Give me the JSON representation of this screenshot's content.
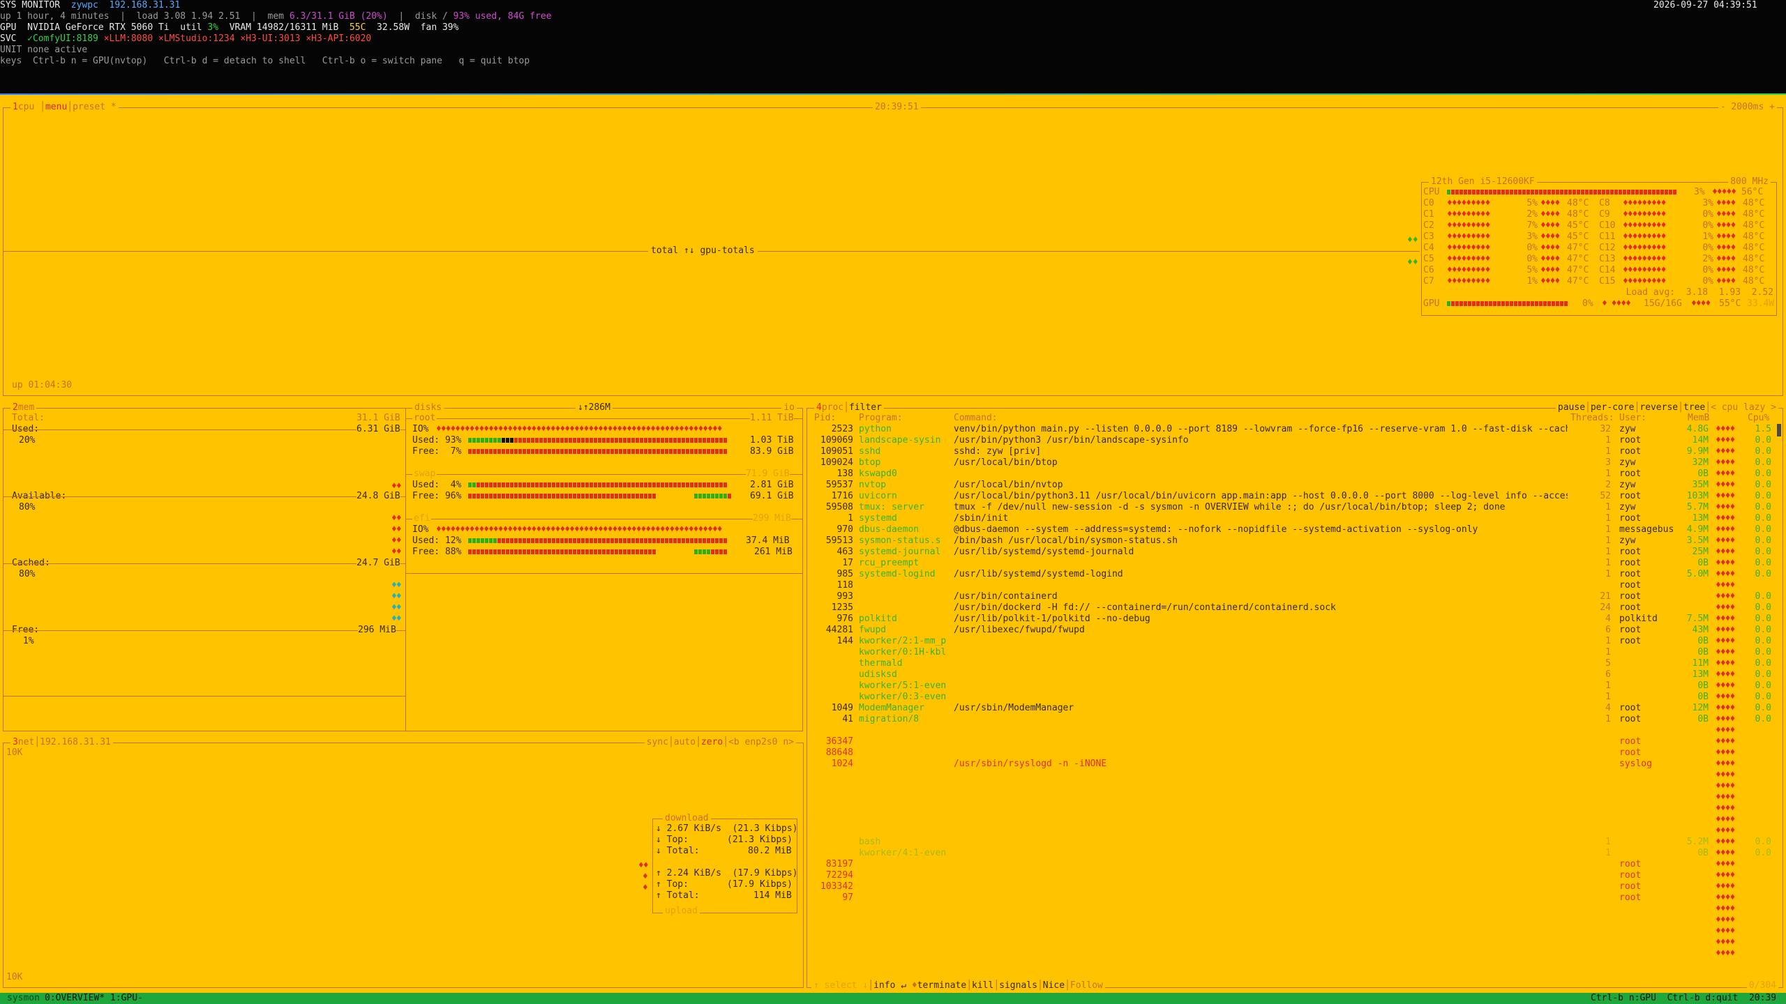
{
  "header": {
    "title": "SYS MONITOR",
    "host": "zywpc",
    "ip": "192.168.31.31",
    "datetime": "2026-09-27 04:39:51",
    "uptime_line": "up 1 hour, 4 minutes  |  load 3.08 1.94 2.51  |  mem ",
    "mem_value": "6.3/31.1 GiB (20%)",
    "disk_label": "  |  disk / ",
    "disk_value": "93% used, 84G free",
    "gpu_label": "GPU  NVIDIA GeForce RTX 5060 Ti  util ",
    "gpu_util": "3%",
    "gpu_vram": "  VRAM 14982/16311 MiB  ",
    "gpu_temp": "55C",
    "gpu_power": "  32.58W  fan 39%",
    "svc_label": "SVC  ",
    "svc_comfy": "✓ComfyUI:8189 ",
    "svc_llm": "×LLM:8080 ",
    "svc_lmstudio": "×LMStudio:1234 ",
    "svc_h3ui": "×H3-UI:3013 ",
    "svc_h3api": "×H3-API:6020",
    "unit_line": "UNIT none active",
    "keys_line": "keys  Ctrl-b n = GPU(nvtop)   Ctrl-b d = detach to shell   Ctrl-b o = switch pane   q = quit btop"
  },
  "cpu_panel": {
    "title_num": "1",
    "title": "cpu",
    "menu": "menu",
    "preset": "preset *",
    "clock": "20:39:51",
    "interval": "- 2000ms +",
    "graph_label": "total ↑↓ gpu-totals",
    "uptime": "up 01:04:30",
    "cpu_model": "12th Gen i5-12600KF",
    "cpu_freq": "800 MHz",
    "cpu_total_label": "CPU",
    "cpu_total_pct": "3%",
    "cpu_total_temp": "56°C",
    "cores_left": [
      {
        "name": "C0",
        "pct": "5%",
        "temp": "48°C"
      },
      {
        "name": "C1",
        "pct": "2%",
        "temp": "48°C"
      },
      {
        "name": "C2",
        "pct": "7%",
        "temp": "45°C"
      },
      {
        "name": "C3",
        "pct": "3%",
        "temp": "45°C"
      },
      {
        "name": "C4",
        "pct": "0%",
        "temp": "47°C"
      },
      {
        "name": "C5",
        "pct": "0%",
        "temp": "47°C"
      },
      {
        "name": "C6",
        "pct": "5%",
        "temp": "47°C"
      },
      {
        "name": "C7",
        "pct": "1%",
        "temp": "47°C"
      }
    ],
    "cores_right": [
      {
        "name": "C8",
        "pct": "3%",
        "temp": "48°C"
      },
      {
        "name": "C9",
        "pct": "0%",
        "temp": "48°C"
      },
      {
        "name": "C10",
        "pct": "0%",
        "temp": "48°C"
      },
      {
        "name": "C11",
        "pct": "1%",
        "temp": "48°C"
      },
      {
        "name": "C12",
        "pct": "0%",
        "temp": "48°C"
      },
      {
        "name": "C13",
        "pct": "2%",
        "temp": "48°C"
      },
      {
        "name": "C14",
        "pct": "0%",
        "temp": "48°C"
      },
      {
        "name": "C15",
        "pct": "0%",
        "temp": "48°C"
      }
    ],
    "load_avg": "Load avg:  3.18  1.93  2.52",
    "gpu_label": "GPU",
    "gpu_pct": "0%",
    "gpu_mem": "15G/16G",
    "gpu_temp": "55°C",
    "gpu_power": "33.4W"
  },
  "mem_panel": {
    "title_num": "2",
    "title": "mem",
    "total_label": "Total:",
    "total_value": "31.1 GiB",
    "used_label": "Used:",
    "used_value": "6.31 GiB",
    "used_pct": "20%",
    "avail_label": "Available:",
    "avail_value": "24.8 GiB",
    "avail_pct": "80%",
    "cached_label": "Cached:",
    "cached_value": "24.7 GiB",
    "cached_pct": "80%",
    "free_label": "Free:",
    "free_value": "296 MiB",
    "free_pct": "1%"
  },
  "disks_panel": {
    "title": "disks",
    "io_label": "io",
    "io_value": "↓↑286M",
    "root": {
      "name": "root",
      "size": "1.11 TiB",
      "io": "IO%",
      "used_label": "Used:",
      "used_pct": "93%",
      "used_val": "1.03 TiB",
      "free_label": "Free:",
      "free_pct": "7%",
      "free_val": "83.9 GiB"
    },
    "swap": {
      "name": "swap",
      "size": "71.9 GiB",
      "used_label": "Used:",
      "used_pct": "4%",
      "used_val": "2.81 GiB",
      "free_label": "Free:",
      "free_pct": "96%",
      "free_val": "69.1 GiB"
    },
    "efi": {
      "name": "efi",
      "size": "299 MiB",
      "io": "IO%",
      "used_label": "Used:",
      "used_pct": "12%",
      "used_val": "37.4 MiB",
      "free_label": "Free:",
      "free_pct": "88%",
      "free_val": "261 MiB"
    }
  },
  "net_panel": {
    "title_num": "3",
    "title": "net",
    "ip": "192.168.31.31",
    "sync": "sync",
    "auto": "auto",
    "zero": "zero",
    "b": "<b",
    "iface": "enp2s0",
    "n": "n>",
    "scale_top": "10K",
    "scale_bottom": "10K",
    "download_title": "download",
    "dl_rate": "2.67 KiB/s  (21.3 Kibps)",
    "dl_top_label": "Top:",
    "dl_top": "(21.3 Kibps)",
    "dl_total_label": "Total:",
    "dl_total": "80.2 MiB",
    "ul_rate": "2.24 KiB/s  (17.9 Kibps)",
    "ul_top_label": "Top:",
    "ul_top": "(17.9 Kibps)",
    "ul_total_label": "Total:",
    "ul_total": "114 MiB",
    "upload_title": "upload"
  },
  "proc_panel": {
    "title_num": "4",
    "title": "proc",
    "filter": "filter",
    "pause": "pause",
    "per_core": "per-core",
    "reverse": "reverse",
    "tree": "tree",
    "sort": "< cpu lazy >",
    "headers": {
      "pid": "Pid:",
      "program": "Program:",
      "command": "Command:",
      "threads": "Threads:",
      "user": "User:",
      "mem": "MemB",
      "cpu": "Cpu%"
    },
    "rows": [
      {
        "pid": "2523",
        "prog": "python",
        "cmd": "venv/bin/python main.py --listen 0.0.0.0 --port 8189 --lowvram --force-fp16 --reserve-vram 1.0 --fast-disk --cach",
        "thr": "32",
        "user": "zyw",
        "mem": "4.8G",
        "cpu": "1.5"
      },
      {
        "pid": "109069",
        "prog": "landscape-sysin",
        "cmd": "/usr/bin/python3 /usr/bin/landscape-sysinfo",
        "thr": "1",
        "user": "root",
        "mem": "14M",
        "cpu": "0.0"
      },
      {
        "pid": "109051",
        "prog": "sshd",
        "cmd": "sshd: zyw [priv]",
        "thr": "1",
        "user": "root",
        "mem": "9.9M",
        "cpu": "0.0"
      },
      {
        "pid": "109024",
        "prog": "btop",
        "cmd": "/usr/local/bin/btop",
        "thr": "3",
        "user": "zyw",
        "mem": "32M",
        "cpu": "0.0"
      },
      {
        "pid": "138",
        "prog": "kswapd0",
        "cmd": "",
        "thr": "1",
        "user": "root",
        "mem": "0B",
        "cpu": "0.0"
      },
      {
        "pid": "59537",
        "prog": "nvtop",
        "cmd": "/usr/local/bin/nvtop",
        "thr": "2",
        "user": "zyw",
        "mem": "35M",
        "cpu": "0.0"
      },
      {
        "pid": "1716",
        "prog": "uvicorn",
        "cmd": "/usr/local/bin/python3.11 /usr/local/bin/uvicorn app.main:app --host 0.0.0.0 --port 8000 --log-level info --acces",
        "thr": "52",
        "user": "root",
        "mem": "103M",
        "cpu": "0.0"
      },
      {
        "pid": "59508",
        "prog": "tmux: server",
        "cmd": "tmux -f /dev/null new-session -d -s sysmon -n OVERVIEW while :; do /usr/local/bin/btop; sleep 2; done",
        "thr": "1",
        "user": "zyw",
        "mem": "5.7M",
        "cpu": "0.0"
      },
      {
        "pid": "1",
        "prog": "systemd",
        "cmd": "/sbin/init",
        "thr": "1",
        "user": "root",
        "mem": "13M",
        "cpu": "0.0"
      },
      {
        "pid": "970",
        "prog": "dbus-daemon",
        "cmd": "@dbus-daemon --system --address=systemd: --nofork --nopidfile --systemd-activation --syslog-only",
        "thr": "1",
        "user": "messagebus",
        "mem": "4.9M",
        "cpu": "0.0"
      },
      {
        "pid": "59513",
        "prog": "sysmon-status.s",
        "cmd": "/bin/bash /usr/local/bin/sysmon-status.sh",
        "thr": "1",
        "user": "zyw",
        "mem": "3.5M",
        "cpu": "0.0"
      },
      {
        "pid": "463",
        "prog": "systemd-journal",
        "cmd": "/usr/lib/systemd/systemd-journald",
        "thr": "1",
        "user": "root",
        "mem": "25M",
        "cpu": "0.0"
      },
      {
        "pid": "17",
        "prog": "rcu_preempt",
        "cmd": "",
        "thr": "1",
        "user": "root",
        "mem": "0B",
        "cpu": "0.0"
      },
      {
        "pid": "985",
        "prog": "systemd-logind",
        "cmd": "/usr/lib/systemd/systemd-logind",
        "thr": "1",
        "user": "root",
        "mem": "5.0M",
        "cpu": "0.0"
      },
      {
        "pid": "118",
        "prog": "",
        "cmd": "",
        "thr": "",
        "user": "root",
        "mem": "",
        "cpu": ""
      },
      {
        "pid": "993",
        "prog": "",
        "cmd": "/usr/bin/containerd",
        "thr": "21",
        "user": "root",
        "mem": "",
        "cpu": "0.0"
      },
      {
        "pid": "1235",
        "prog": "",
        "cmd": "/usr/bin/dockerd -H fd:// --containerd=/run/containerd/containerd.sock",
        "thr": "24",
        "user": "root",
        "mem": "",
        "cpu": "0.0"
      },
      {
        "pid": "976",
        "prog": "polkitd",
        "cmd": "/usr/lib/polkit-1/polkitd --no-debug",
        "thr": "4",
        "user": "polkitd",
        "mem": "7.5M",
        "cpu": "0.0"
      },
      {
        "pid": "44281",
        "prog": "fwupd",
        "cmd": "/usr/libexec/fwupd/fwupd",
        "thr": "6",
        "user": "root",
        "mem": "43M",
        "cpu": "0.0"
      },
      {
        "pid": "144",
        "prog": "kworker/2:1-mm_p",
        "cmd": "",
        "thr": "1",
        "user": "root",
        "mem": "0B",
        "cpu": "0.0"
      },
      {
        "pid": "",
        "prog": "kworker/0:1H-kbl",
        "cmd": "",
        "thr": "1",
        "user": "",
        "mem": "0B",
        "cpu": "0.0"
      },
      {
        "pid": "",
        "prog": "thermald",
        "cmd": "",
        "thr": "5",
        "user": "",
        "mem": "11M",
        "cpu": "0.0"
      },
      {
        "pid": "",
        "prog": "udisksd",
        "cmd": "",
        "thr": "6",
        "user": "",
        "mem": "13M",
        "cpu": "0.0"
      },
      {
        "pid": "",
        "prog": "kworker/5:1-even",
        "cmd": "",
        "thr": "1",
        "user": "",
        "mem": "0B",
        "cpu": "0.0"
      },
      {
        "pid": "",
        "prog": "kworker/0:3-even",
        "cmd": "",
        "thr": "1",
        "user": "",
        "mem": "0B",
        "cpu": "0.0"
      },
      {
        "pid": "1049",
        "prog": "ModemManager",
        "cmd": "/usr/sbin/ModemManager",
        "thr": "4",
        "user": "root",
        "mem": "12M",
        "cpu": "0.0"
      },
      {
        "pid": "41",
        "prog": "migration/8",
        "cmd": "",
        "thr": "1",
        "user": "root",
        "mem": "0B",
        "cpu": "0.0"
      }
    ],
    "dim_rows": [
      {
        "pid": "36347",
        "prog": "",
        "cmd": "",
        "user": "root"
      },
      {
        "pid": "88648",
        "prog": "",
        "cmd": "",
        "user": "root"
      },
      {
        "pid": "1024",
        "prog": "",
        "cmd": "/usr/sbin/rsyslogd -n -iNONE",
        "user": "syslog"
      }
    ],
    "ghost_rows": [
      {
        "prog": "bash",
        "thr": "1",
        "mem": "5.2M",
        "cpu": "0.0"
      },
      {
        "prog": "kworker/4:1-even",
        "thr": "1",
        "mem": "0B",
        "cpu": "0.0"
      }
    ],
    "tail_rows": [
      {
        "pid": "83197",
        "user": "root"
      },
      {
        "pid": "72294",
        "user": "root"
      },
      {
        "pid": "103342",
        "user": "root"
      },
      {
        "pid": "97",
        "user": "root"
      }
    ],
    "footer": {
      "select": "↑ select ↓",
      "info": "info ↵",
      "terminate": "terminate",
      "kill": "kill",
      "signals": "signals",
      "nice": "Nice",
      "follow": "Follow",
      "count": "0/304"
    }
  },
  "tmux_bar": {
    "session": "sysmon",
    "windows": "0:OVERVIEW* 1:GPU-",
    "right_hint": "Ctrl-b n:GPU  Ctrl-b d:quit  20:39"
  },
  "colors": {
    "background": "#ffc300",
    "border": "#c7711c",
    "accent_red": "#e0301c",
    "accent_green": "#3bb21d",
    "statusbar": "#1ea73c"
  }
}
